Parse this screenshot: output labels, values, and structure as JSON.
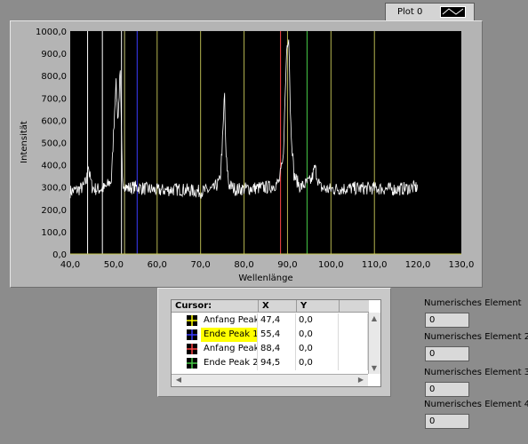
{
  "legend": {
    "plot_name": "Plot 0"
  },
  "chart_data": {
    "type": "line",
    "xlabel": "Wellenlänge",
    "ylabel": "Intensität",
    "xlim": [
      40.0,
      130.0
    ],
    "ylim": [
      0.0,
      1000.0
    ],
    "x_ticks": [
      "40,0",
      "50,0",
      "60,0",
      "70,0",
      "80,0",
      "90,0",
      "100,0",
      "110,0",
      "120,0",
      "130,0"
    ],
    "y_ticks": [
      "0,0",
      "100,0",
      "200,0",
      "300,0",
      "400,0",
      "500,0",
      "600,0",
      "700,0",
      "800,0",
      "900,0",
      "1000,0"
    ],
    "background": "#000000",
    "series": [
      {
        "color": "#ffffff",
        "baseline_x": [
          40.0,
          42.0,
          43.0,
          43.8,
          44.1,
          44.4,
          45.0,
          46.0,
          48.0,
          49.5,
          50.5,
          51.0,
          51.5,
          52.0,
          53.0,
          55.0,
          60.0,
          65.0,
          70.0,
          73.0,
          74.5,
          75.2,
          75.5,
          75.8,
          76.5,
          78.0,
          82.0,
          86.0,
          88.0,
          89.0,
          89.8,
          90.3,
          90.7,
          91.5,
          93.0,
          95.5,
          96.3,
          96.8,
          97.5,
          99.0,
          105.0,
          110.0,
          115.0,
          120.0
        ],
        "baseline_y": [
          280,
          290,
          300,
          330,
          420,
          360,
          300,
          290,
          295,
          330,
          780,
          600,
          820,
          330,
          295,
          300,
          285,
          290,
          280,
          290,
          330,
          560,
          740,
          450,
          310,
          290,
          295,
          300,
          320,
          420,
          920,
          990,
          600,
          350,
          300,
          330,
          390,
          350,
          300,
          290,
          295,
          295,
          290,
          300
        ]
      }
    ],
    "vertical_cursors": [
      {
        "x": 44.0,
        "color": "#ffffff"
      },
      {
        "x": 47.4,
        "color": "#ffffff"
      },
      {
        "x": 51.8,
        "color": "#ffffff"
      },
      {
        "x": 52.5,
        "color": "#c8c878"
      },
      {
        "x": 55.4,
        "color": "#3c3cff"
      },
      {
        "x": 60.0,
        "color": "#b4b450"
      },
      {
        "x": 70.0,
        "color": "#b4b450"
      },
      {
        "x": 80.0,
        "color": "#b4b450"
      },
      {
        "x": 88.4,
        "color": "#ff4646"
      },
      {
        "x": 90.0,
        "color": "#b4b450"
      },
      {
        "x": 94.5,
        "color": "#46c846"
      },
      {
        "x": 100.0,
        "color": "#b4b450"
      },
      {
        "x": 110.0,
        "color": "#b4b450"
      }
    ]
  },
  "cursor_table": {
    "headers": [
      "Cursor:",
      "X",
      "Y"
    ],
    "rows": [
      {
        "name": "Anfang Peak",
        "x": "47,4",
        "y": "0,0",
        "color": "#ffff00",
        "highlight": false
      },
      {
        "name": "Ende Peak 1",
        "x": "55,4",
        "y": "0,0",
        "color": "#3c3cff",
        "highlight": true
      },
      {
        "name": "Anfang Peak",
        "x": "88,4",
        "y": "0,0",
        "color": "#ff4646",
        "highlight": false
      },
      {
        "name": "Ende Peak 2",
        "x": "94,5",
        "y": "0,0",
        "color": "#46c846",
        "highlight": false
      }
    ]
  },
  "numeric": [
    {
      "label": "Numerisches Element",
      "value": "0"
    },
    {
      "label": "Numerisches Element 2",
      "value": "0"
    },
    {
      "label": "Numerisches Element 3",
      "value": "0"
    },
    {
      "label": "Numerisches Element 4",
      "value": "0"
    }
  ]
}
